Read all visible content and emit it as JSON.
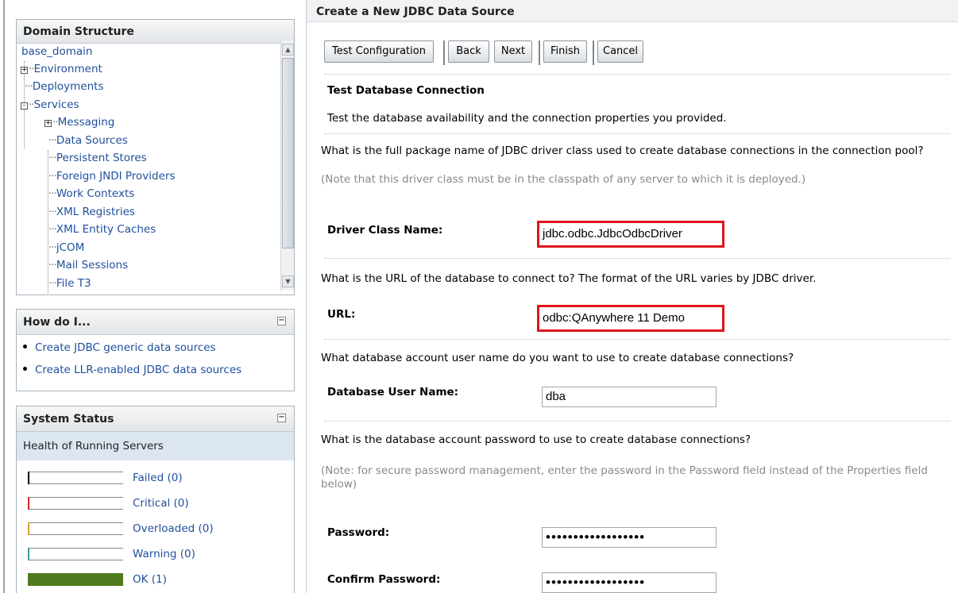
{
  "domain_panel": {
    "title": "Domain Structure",
    "tree": [
      {
        "label": "base_domain"
      },
      {
        "label": "Environment",
        "expander": "+"
      },
      {
        "label": "Deployments"
      },
      {
        "label": "Services",
        "expander": "-"
      },
      {
        "label": "Messaging",
        "expander": "+"
      },
      {
        "label": "Data Sources"
      },
      {
        "label": "Persistent Stores"
      },
      {
        "label": "Foreign JNDI Providers"
      },
      {
        "label": "Work Contexts"
      },
      {
        "label": "XML Registries"
      },
      {
        "label": "XML Entity Caches"
      },
      {
        "label": "jCOM"
      },
      {
        "label": "Mail Sessions"
      },
      {
        "label": "File T3"
      }
    ]
  },
  "howdo_panel": {
    "title": "How do I...",
    "collapse_glyph": "−",
    "links": [
      "Create JDBC generic data sources",
      "Create LLR-enabled JDBC data sources"
    ]
  },
  "status_panel": {
    "title": "System Status",
    "collapse_glyph": "−",
    "subtitle": "Health of Running Servers",
    "rows": [
      {
        "label": "Failed (0)",
        "color": "#000000",
        "fill": 0
      },
      {
        "label": "Critical (0)",
        "color": "#d12a2a",
        "fill": 0
      },
      {
        "label": "Overloaded (0)",
        "color": "#d9a03a",
        "fill": 0
      },
      {
        "label": "Warning (0)",
        "color": "#3f9a9a",
        "fill": 0
      },
      {
        "label": "OK (1)",
        "color": "#4f7a1e",
        "fill": 1
      }
    ]
  },
  "main": {
    "title": "Create a New JDBC Data Source",
    "buttons": {
      "test": "Test Configuration",
      "back": "Back",
      "next": "Next",
      "finish": "Finish",
      "cancel": "Cancel"
    },
    "section_title": "Test Database Connection",
    "section_desc": "Test the database availability and the connection properties you provided.",
    "driver_question": "What is the full package name of JDBC driver class used to create database connections in the connection pool?",
    "driver_note": "(Note that this driver class must be in the classpath of any server to which it is deployed.)",
    "driver_label": "Driver Class Name:",
    "driver_value": "jdbc.odbc.JdbcOdbcDriver",
    "url_question": "What is the URL of the database to connect to? The format of the URL varies by JDBC driver.",
    "url_label": "URL:",
    "url_value": "odbc:QAnywhere 11 Demo",
    "user_question": "What database account user name do you want to use to create database connections?",
    "user_label": "Database User Name:",
    "user_value": "dba",
    "password_question": "What is the database account password to use to create database connections?",
    "password_note_1": "(Note: for secure password management, enter the password in the Password field instead of the Properties field",
    "password_note_2": "below)",
    "password_label": "Password:",
    "password_value": "••••••••••••••••••",
    "confirm_label": "Confirm Password:",
    "confirm_value": "••••••••••••••••••"
  }
}
